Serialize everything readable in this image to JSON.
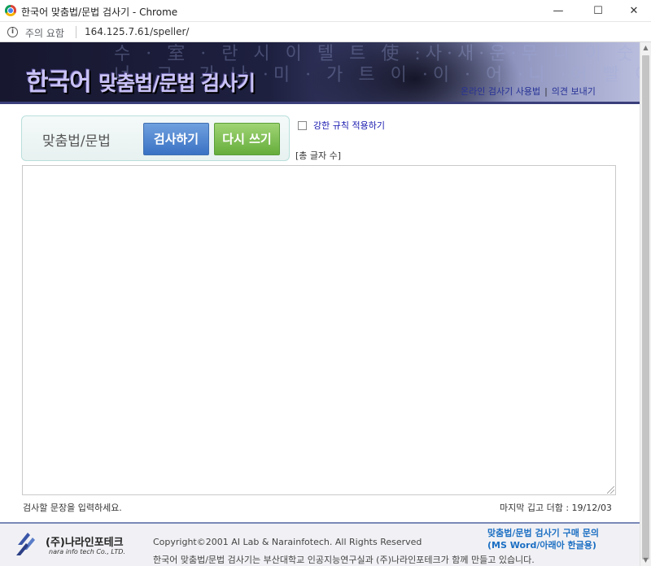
{
  "window": {
    "title": "한국어 맞춤법/문법 검사기 - Chrome",
    "min_glyph": "—",
    "max_glyph": "☐",
    "close_glyph": "✕"
  },
  "addressbar": {
    "warning": "주의 요함",
    "url": "164.125.7.61/speller/"
  },
  "banner": {
    "title_main": "한국어",
    "title_rest": "맞춤법/문법 검사기",
    "pattern_line1": "수 · 室 · 란 시 이 텔 트 使 :사·새·운·무 니 이 숫 나",
    "pattern_line2": "너 ·그· 가 나 ·미 · 가 트 이 ·이 · 어 ·니 ·어 빨 이 가",
    "links": [
      "온라인 검사기 사용법",
      "의견 보내기"
    ],
    "link_sep": "|"
  },
  "controls": {
    "label": "맞춤법/문법",
    "check_button": "검사하기",
    "reset_button": "다시 쓰기",
    "strict_label": "강한 규칙 적용하기",
    "char_count": "[총 글자 수]"
  },
  "editor": {
    "value": "",
    "hint": "검사할 문장을 입력하세요.",
    "last_update": "마지막 깁고 더함 : 19/12/03"
  },
  "footer": {
    "logo_text": "(주)나라인포테크",
    "logo_sub": "nara info tech Co., LTD.",
    "copyright": "Copyright©2001 AI Lab & Narainfotech. All Rights Reserved",
    "credit": "한국어 맞춤법/문법 검사기는 부산대학교 인공지능연구실과 (주)나라인포테크가 함께 만들고 있습니다.",
    "purchase_line1": "맞춤법/문법 검사기 구매 문의",
    "purchase_line2": "(MS Word/아래아 한글용)"
  },
  "colors": {
    "check_button": "#3a72c4",
    "reset_button": "#66ad3c",
    "link": "#263196",
    "purchase": "#1c6fc3"
  }
}
